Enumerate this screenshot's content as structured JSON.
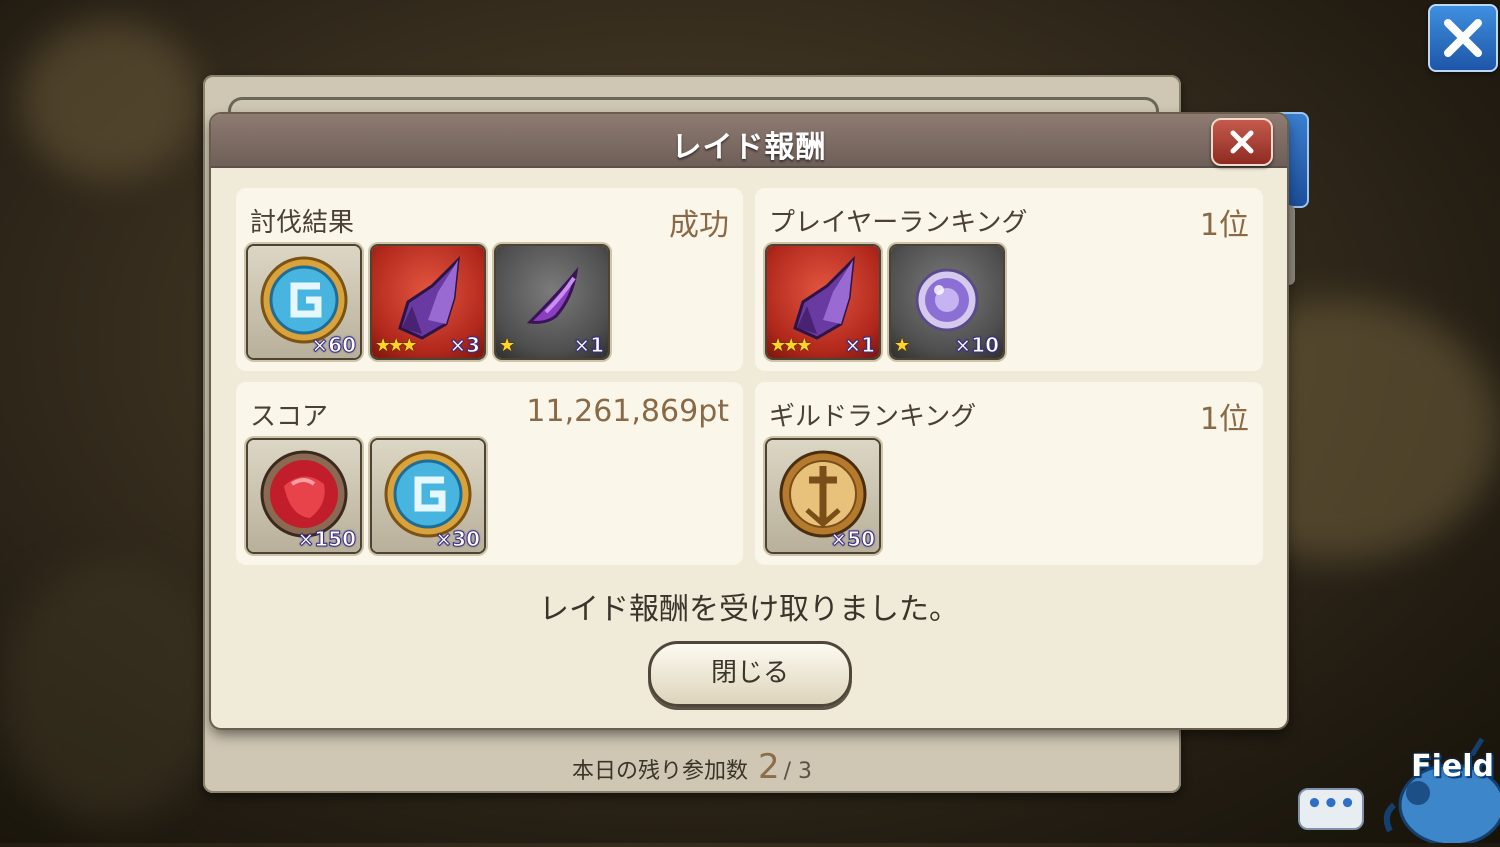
{
  "dialog": {
    "title": "レイド報酬",
    "message": "レイド報酬を受け取りました。",
    "close_button": "閉じる"
  },
  "sections": {
    "result": {
      "label": "討伐結果",
      "value": "成功",
      "items": [
        {
          "icon": "g-coin-icon",
          "qty": "×60",
          "stars": ""
        },
        {
          "icon": "purple-crystal-icon",
          "qty": "×3",
          "stars": "★★★"
        },
        {
          "icon": "purple-fang-icon",
          "qty": "×1",
          "stars": "★"
        }
      ]
    },
    "player_ranking": {
      "label": "プレイヤーランキング",
      "value": "1位",
      "items": [
        {
          "icon": "purple-crystal-icon",
          "qty": "×1",
          "stars": "★★★"
        },
        {
          "icon": "purple-orb-icon",
          "qty": "×10",
          "stars": "★"
        }
      ]
    },
    "score": {
      "label": "スコア",
      "value": "11,261,869pt",
      "items": [
        {
          "icon": "red-gem-icon",
          "qty": "×150",
          "stars": ""
        },
        {
          "icon": "g-coin-icon",
          "qty": "×30",
          "stars": ""
        }
      ]
    },
    "guild_ranking": {
      "label": "ギルドランキング",
      "value": "1位",
      "items": [
        {
          "icon": "guild-medal-icon",
          "qty": "×50",
          "stars": ""
        }
      ]
    }
  },
  "footer": {
    "remaining_label": "本日の残り参加数",
    "remaining_current": "2",
    "remaining_total": "/ 3"
  },
  "hud": {
    "field_label": "Field",
    "chat_label": "•••"
  },
  "colors": {
    "accent_value": "#8a6a46",
    "qty_outline": "#3a2e8a",
    "star": "#ffd42a",
    "blue_button": "#1e56a8"
  }
}
